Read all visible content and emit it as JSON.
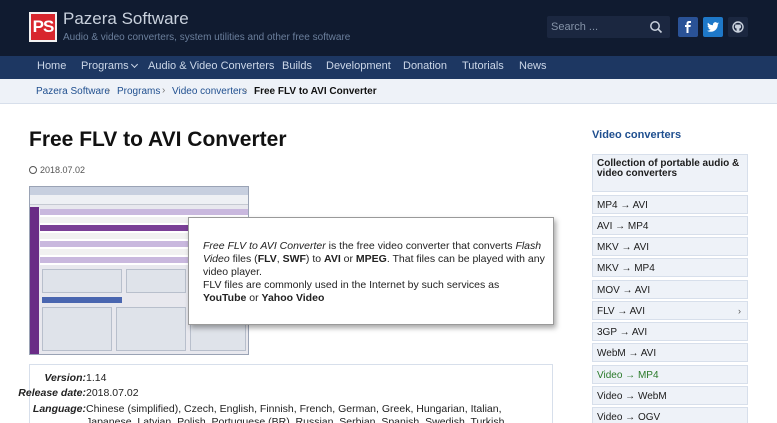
{
  "header": {
    "logo_text": "PS",
    "site_title": "Pazera Software",
    "tagline": "Audio & video converters, system utilities and other free software",
    "search_placeholder": "Search ..."
  },
  "nav": {
    "items": [
      "Home",
      "Programs",
      "Audio & Video Converters",
      "Builds",
      "Development",
      "Donation",
      "Tutorials",
      "News"
    ]
  },
  "breadcrumb": {
    "items": [
      "Pazera Software",
      "Programs",
      "Video converters",
      "Free FLV to AVI Converter"
    ],
    "separator": "›"
  },
  "main": {
    "title": "Free FLV to AVI Converter",
    "date": "2018.07.02",
    "popup": {
      "p1_a": "Free FLV to AVI Converter",
      "p1_b": " is the free video converter that converts ",
      "p1_c": "Flash Video",
      "p1_d": " files (",
      "p1_e": "FLV",
      "p1_f": ", ",
      "p1_g": "SWF",
      "p1_h": ") to ",
      "p1_i": "AVI",
      "p1_j": " or ",
      "p1_k": "MPEG",
      "p1_l": ". That files can be played with any video player.",
      "p2_a": "FLV files are commonly used in the Internet by such services as ",
      "p2_b": "YouTube",
      "p2_c": " or ",
      "p2_d": "Yahoo Video"
    },
    "info": {
      "version_label": "Version:",
      "version": "1.14",
      "release_label": "Release date:",
      "release": "2018.07.02",
      "language_label": "Language:",
      "languages": "Chinese (simplified), Czech, English, Finnish, French, German, Greek, Hungarian, Italian, Japanese, Latvian, Polish, Portuguese (BR), Russian, Serbian, Spanish, Swedish, Turkish"
    }
  },
  "sidebar": {
    "heading": "Video converters",
    "items": [
      "Collection of portable audio & video converters",
      "MP4 → AVI",
      "AVI → MP4",
      "MKV → AVI",
      "MKV → MP4",
      "MOV → AVI",
      "FLV → AVI",
      "3GP → AVI",
      "WebM → AVI",
      "Video → MP4",
      "Video → WebM",
      "Video → OGV"
    ],
    "active_index": 9,
    "arrow": "›"
  },
  "colors": {
    "header_bg": "#101b30",
    "nav_bg": "#1d3762",
    "logo_red": "#d8262d",
    "link_blue": "#1f4f8f",
    "active_green": "#2a7a2a"
  }
}
